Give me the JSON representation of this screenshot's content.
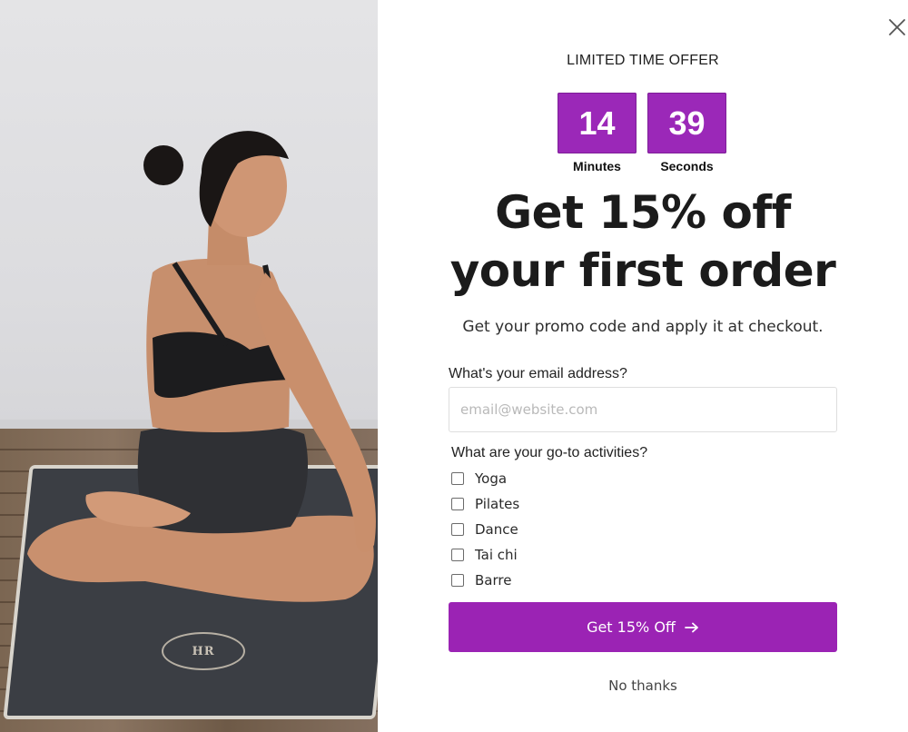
{
  "popup": {
    "close_icon": "close-icon",
    "offer_label": "LIMITED TIME OFFER",
    "timer": {
      "minutes": "14",
      "minutes_label": "Minutes",
      "seconds": "39",
      "seconds_label": "Seconds"
    },
    "headline_line1": "Get 15% off",
    "headline_line2": "your first order",
    "subtext": "Get your promo code and apply it at checkout.",
    "email": {
      "label": "What's your email address?",
      "placeholder": "email@website.com",
      "value": ""
    },
    "activities": {
      "label": "What are your go-to activities?",
      "options": [
        {
          "label": "Yoga",
          "checked": false
        },
        {
          "label": "Pilates",
          "checked": false
        },
        {
          "label": "Dance",
          "checked": false
        },
        {
          "label": "Tai chi",
          "checked": false
        },
        {
          "label": "Barre",
          "checked": false
        }
      ]
    },
    "cta_label": "Get 15% Off",
    "cta_icon": "arrow-right-icon",
    "no_thanks": "No thanks"
  },
  "colors": {
    "accent": "#9b23b4",
    "timer_bg": "#9b28b8",
    "text": "#1b1b1b"
  }
}
